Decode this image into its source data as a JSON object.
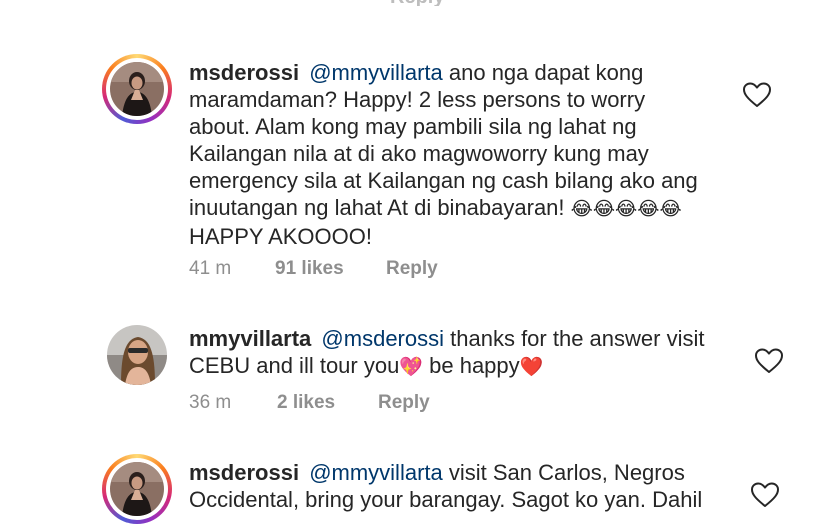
{
  "comments": [
    {
      "username": "msderossi",
      "mention": "@mmyvillarta",
      "lines": [
        "ano nga dapat kong",
        "maramdaman? Happy! 2 less persons to worry",
        "about. Alam kong may pambili sila ng lahat ng",
        "Kailangan nila at di ako magwoworry kung may",
        "emergency sila at Kailangan ng cash bilang ako ang",
        "inuutangan ng lahat At di binabayaran!",
        "HAPPY AKOOOO!"
      ],
      "emoji": "😂😂😂😂😂",
      "time": "41 m",
      "likes": "91 likes",
      "reply": "Reply"
    },
    {
      "username": "mmyvillarta",
      "mention": "@msderossi",
      "lines": [
        "thanks for the answer visit",
        "CEBU and ill tour you",
        "be happy"
      ],
      "emoji1": "💖",
      "emoji2": "❤️",
      "time": "36 m",
      "likes": "2 likes",
      "reply": "Reply"
    },
    {
      "username": "msderossi",
      "mention": "@mmyvillarta",
      "lines": [
        "visit San Carlos, Negros",
        "Occidental, bring your barangay. Sagot ko yan. Dahil"
      ]
    }
  ],
  "icons": {
    "like": "heart-icon",
    "story_ring": "#d62976"
  }
}
